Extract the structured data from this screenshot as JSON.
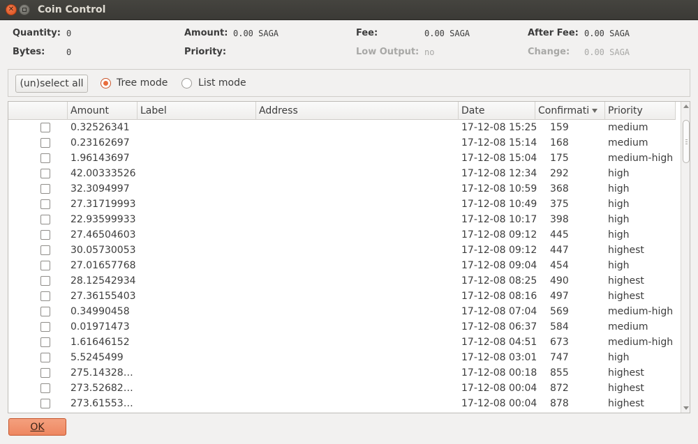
{
  "window": {
    "title": "Coin Control"
  },
  "summary": {
    "quantity_label": "Quantity:",
    "quantity": "0",
    "bytes_label": "Bytes:",
    "bytes": "0",
    "amount_label": "Amount:",
    "amount": "0.00 SAGA",
    "priority_label": "Priority:",
    "priority": "",
    "fee_label": "Fee:",
    "fee": "0.00 SAGA",
    "low_output_label": "Low Output:",
    "low_output": "no",
    "after_fee_label": "After Fee:",
    "after_fee": "0.00 SAGA",
    "change_label": "Change:",
    "change": "0.00 SAGA"
  },
  "modes": {
    "unselect_all": "(un)select all",
    "tree_mode": "Tree mode",
    "list_mode": "List mode",
    "selected": "tree"
  },
  "table": {
    "columns": [
      "",
      "Amount",
      "Label",
      "Address",
      "Date",
      "Confirmati",
      "Priority"
    ],
    "sort_column": "Confirmati",
    "rows": [
      {
        "amount": "0.32526341",
        "label": "",
        "address": "",
        "date": "17-12-08 15:25",
        "confirmations": "159",
        "priority": "medium"
      },
      {
        "amount": "0.23162697",
        "label": "",
        "address": "",
        "date": "17-12-08 15:14",
        "confirmations": "168",
        "priority": "medium"
      },
      {
        "amount": "1.96143697",
        "label": "",
        "address": "",
        "date": "17-12-08 15:04",
        "confirmations": "175",
        "priority": "medium-high"
      },
      {
        "amount": "42.00333526",
        "label": "",
        "address": "",
        "date": "17-12-08 12:34",
        "confirmations": "292",
        "priority": "high"
      },
      {
        "amount": "32.3094997",
        "label": "",
        "address": "",
        "date": "17-12-08 10:59",
        "confirmations": "368",
        "priority": "high"
      },
      {
        "amount": "27.31719993",
        "label": "",
        "address": "",
        "date": "17-12-08 10:49",
        "confirmations": "375",
        "priority": "high"
      },
      {
        "amount": "22.93599933",
        "label": "",
        "address": "",
        "date": "17-12-08 10:17",
        "confirmations": "398",
        "priority": "high"
      },
      {
        "amount": "27.46504603",
        "label": "",
        "address": "",
        "date": "17-12-08 09:12",
        "confirmations": "445",
        "priority": "high"
      },
      {
        "amount": "30.05730053",
        "label": "",
        "address": "",
        "date": "17-12-08 09:12",
        "confirmations": "447",
        "priority": "highest"
      },
      {
        "amount": "27.01657768",
        "label": "",
        "address": "",
        "date": "17-12-08 09:04",
        "confirmations": "454",
        "priority": "high"
      },
      {
        "amount": "28.12542934",
        "label": "",
        "address": "",
        "date": "17-12-08 08:25",
        "confirmations": "490",
        "priority": "highest"
      },
      {
        "amount": "27.36155403",
        "label": "",
        "address": "",
        "date": "17-12-08 08:16",
        "confirmations": "497",
        "priority": "highest"
      },
      {
        "amount": "0.34990458",
        "label": "",
        "address": "",
        "date": "17-12-08 07:04",
        "confirmations": "569",
        "priority": "medium-high"
      },
      {
        "amount": "0.01971473",
        "label": "",
        "address": "",
        "date": "17-12-08 06:37",
        "confirmations": "584",
        "priority": "medium"
      },
      {
        "amount": "1.61646152",
        "label": "",
        "address": "",
        "date": "17-12-08 04:51",
        "confirmations": "673",
        "priority": "medium-high"
      },
      {
        "amount": "5.5245499",
        "label": "",
        "address": "",
        "date": "17-12-08 03:01",
        "confirmations": "747",
        "priority": "high"
      },
      {
        "amount": "275.14328…",
        "label": "",
        "address": "",
        "date": "17-12-08 00:18",
        "confirmations": "855",
        "priority": "highest"
      },
      {
        "amount": "273.52682…",
        "label": "",
        "address": "",
        "date": "17-12-08 00:04",
        "confirmations": "872",
        "priority": "highest"
      },
      {
        "amount": "273.61553…",
        "label": "",
        "address": "",
        "date": "17-12-08 00:04",
        "confirmations": "878",
        "priority": "highest"
      }
    ]
  },
  "ok_button": "OK",
  "colors": {
    "accent": "#e96c3c",
    "titlebar": "#3c3b37"
  }
}
